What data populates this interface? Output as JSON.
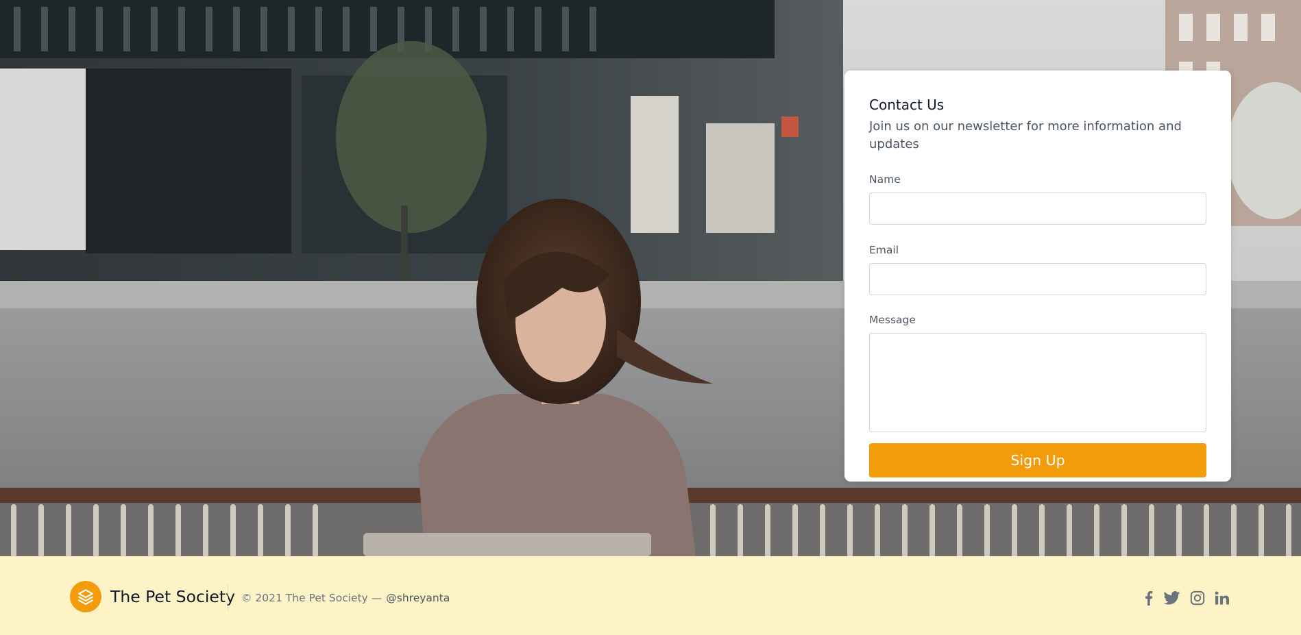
{
  "contact": {
    "title": "Contact Us",
    "subtitle": "Join us on our newsletter for more information and updates",
    "fields": {
      "name_label": "Name",
      "name_value": "",
      "email_label": "Email",
      "email_value": "",
      "message_label": "Message",
      "message_value": ""
    },
    "submit_label": "Sign Up"
  },
  "footer": {
    "brand": "The Pet Society",
    "copyright": "© 2021 The Pet Society —",
    "handle": "@shreyanta",
    "social": [
      "facebook-icon",
      "twitter-icon",
      "instagram-icon",
      "linkedin-icon"
    ]
  },
  "colors": {
    "accent": "#f39c0b",
    "footer_bg": "#fef3c7",
    "card_bg": "#ffffff"
  }
}
